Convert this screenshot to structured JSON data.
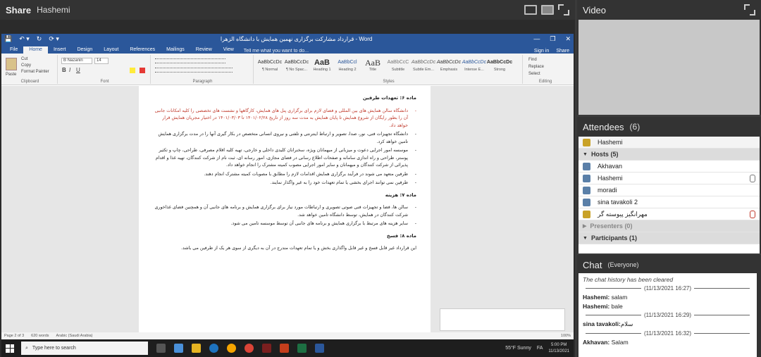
{
  "share": {
    "title": "Share",
    "presenter": "Hashemi"
  },
  "word": {
    "doc_title": "قرارداد مشارکت برگزاری نهمین همایش با دانشگاه الزهرا - Word",
    "quick_access": [
      "💾",
      "↶ ▾",
      "↻",
      "⟳ ▾"
    ],
    "window_controls": [
      "—",
      "❐",
      "✕"
    ],
    "tabs": [
      "File",
      "Home",
      "Insert",
      "Design",
      "Layout",
      "References",
      "Mailings",
      "Review",
      "View"
    ],
    "tell_me": "Tell me what you want to do...",
    "sign_in": "Sign in",
    "share": "Share",
    "clipboard": {
      "paste": "Paste",
      "cut": "Cut",
      "copy": "Copy",
      "format_painter": "Format Painter",
      "label": "Clipboard"
    },
    "font": {
      "name": "B Nazanin",
      "size": "14",
      "label": "Font",
      "bold": "B",
      "italic": "I",
      "underline": "U"
    },
    "paragraph_label": "Paragraph",
    "styles_label": "Styles",
    "editing": {
      "find": "Find",
      "replace": "Replace",
      "select": "Select",
      "label": "Editing"
    },
    "styles": [
      {
        "sample": "AaBbCcDc",
        "name": "¶ Normal"
      },
      {
        "sample": "AaBbCcDc",
        "name": "¶ No Spac..."
      },
      {
        "sample": "AaB",
        "name": "Heading 1"
      },
      {
        "sample": "AaBbCcl",
        "name": "Heading 2"
      },
      {
        "sample": "AaB",
        "name": "Title"
      },
      {
        "sample": "AaBbCcC",
        "name": "Subtitle"
      },
      {
        "sample": "AaBbCcDc",
        "name": "Subtle Em..."
      },
      {
        "sample": "AaBbCcDc",
        "name": "Emphasis"
      },
      {
        "sample": "AaBbCcDc",
        "name": "Intense E..."
      },
      {
        "sample": "AaBbCcDc",
        "name": "Strong"
      }
    ],
    "document": {
      "h6": "ماده ۶: تعهدات طرفین",
      "b1": "دانشگاه سالن همایش های بین المللی و فضای لازم برای برگزاری پنل های همایش، کارگاهها و نشست های تخصصی را کلیه امکانات جانبی آن را بطور رایگان از شروع همایش تا پایان همایش به مدت سه روز از تاریخ ۱۴۰۱/۰۲/۲۸ تا ۱۴۰۱/۰۳/۰۳ در اختیار مجریان همایش قرار خواهد داد.",
      "b2": "دانشگاه تجهیزات فنی، نور، صدا، تصویر و ارتباط اینترنتی و تلفنی و نیروی انسانی متخصص در بکار گیری آنها را در مدت برگزاری همایش تامین خواهد کرد.",
      "b3": "موسسه امور اجرایی دعوت و میزبانی از میهمانان ویژه، سخنرانان کلیدی داخلی و خارجی، تهیه کلیه اقلام مصرفی، طراحی، چاپ و تکثیر پوستر، طراحی و راه اندازی سامانه و صفحات اطلاع رسانی در فضای مجازی، امور رسانه ای، ثبت نام از شرکت کنندگان، تهیه غذا و اقدام پذیرائی از شرکت کنندگان و میهمانان و سایر امور اجرایی مصوب کمیته مشترک را انجام خواهد داد.",
      "b4": "طرفین متعهد می شوند در فرآیند برگزاری همایش اقدامات لازم را مطابق با مصوبات کمیته مشترک انجام دهند.",
      "b5": "طرفین نمی توانند اجرای بخشی یا تمام تعهدات خود را به غیر واگذار نمایند.",
      "h7": "ماده ۷: هزینه",
      "c1": "سالن ها، فضا و تجهیزات فنی صوتی تصویری و ارتباطات مورد نیاز برای برگزاری همایش و برنامه های جانبی آن و همچنین فضای غذاخوری شرکت کنندگان در همایش، توسط دانشگاه تامین خواهد شد.",
      "c2": "سایر هزینه های مرتبط با برگزاری همایش و برنامه های جانبی آن توسط موسسه تامین می شود.",
      "h8": "ماده ۸: فسخ",
      "p8": "این قرارداد غیر قابل فسخ و غیر قابل واگذاری بخش و یا تمام تعهدات مندرج در آن به دیگری از سوی هر یک از طرفین می باشد."
    },
    "status": {
      "page": "Page 2 of 3",
      "words": "620 words",
      "lang": "Arabic (Saudi Arabia)",
      "zoom": "100%"
    }
  },
  "taskbar": {
    "search": "Type here to search",
    "weather": "55°F Sunny",
    "lang": "FA",
    "time": "5:00 PM",
    "date": "11/13/2021"
  },
  "video": {
    "title": "Video"
  },
  "attendees": {
    "title": "Attendees",
    "count": "(6)",
    "me": "Hashemi",
    "hosts_label": "Hosts",
    "hosts_count": "(5)",
    "hosts": [
      "Akhavan",
      "Hashemi",
      "moradi",
      "sina tavakoli 2",
      "مهرانگیز پیوسته گر"
    ],
    "presenters_label": "Presenters",
    "presenters_count": "(0)",
    "participants_label": "Participants",
    "participants_count": "(1)"
  },
  "chat": {
    "title": "Chat",
    "scope": "(Everyone)",
    "cleared": "The chat history has been cleared",
    "t1": "(11/13/2021 16:27)",
    "m1_name": "Hashemi:",
    "m1_text": "salam",
    "m2_name": "Hashemi:",
    "m2_text": "bale",
    "t2": "(11/13/2021 16:29)",
    "m3_name": "sina tavakoli:",
    "m3_text": "سلام",
    "t3": "(11/13/2021 16:32)",
    "m4_name": "Akhavan:",
    "m4_text": "Salam"
  }
}
